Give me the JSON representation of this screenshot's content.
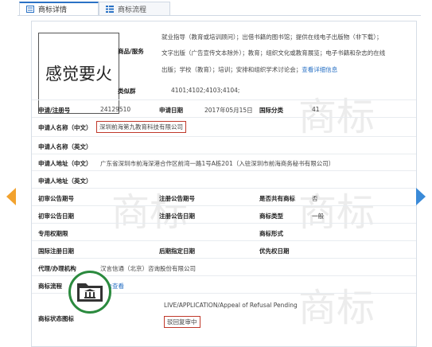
{
  "tabs": [
    {
      "label": "商标详情"
    },
    {
      "label": "商标流程"
    }
  ],
  "watermark": "商标",
  "trademark_name": "感觉要火",
  "goods_label": "商品/服务",
  "goods_lines": [
    "就业指导（教育或培训顾问）；出借书籍的图书馆；提供在线电子出版物（非下载）；",
    "文字出版（广告宣传文本除外）；教育；组织文化或教育展览；电子书籍和杂志的在线",
    "出版；学校（教育）；培训；安排和组织学术讨论会；查看详细信息"
  ],
  "goods_more": "查看详细信息",
  "group_label": "类似群",
  "group_value": "4101;4102;4103;4104;",
  "rows": {
    "reg_no_label": "申请/注册号",
    "reg_no": "24129510",
    "app_date_label": "申请日期",
    "app_date": "2017年05月15日",
    "class_label": "国际分类",
    "class_value": "41",
    "applicant_cn_label": "申请人名称（中文）",
    "applicant_cn": "深圳前海第九教育科技有限公司",
    "applicant_en_label": "申请人名称（英文）",
    "address_cn_label": "申请人地址（中文）",
    "address_cn": "广东省深圳市前海深港合作区前湾一路1号A栋201（入驻深圳市前海商务秘书有限公司）",
    "address_en_label": "申请人地址（英文）",
    "prelim_no_label": "初审公告期号",
    "reg_pub_no_label": "注册公告期号",
    "shared_label": "是否共有商标",
    "shared_value": "否",
    "prelim_date_label": "初审公告日期",
    "reg_pub_date_label": "注册公告日期",
    "type_label": "商标类型",
    "type_value": "一般",
    "exclusive_label": "专用权期限",
    "form_label": "商标形式",
    "intl_date_label": "国际注册日期",
    "later_date_label": "后期指定日期",
    "priority_label": "优先权日期",
    "agent_label": "代理/办理机构",
    "agent_value": "汉言信通（北京）咨询股份有限公司",
    "process_label": "商标流程",
    "process_link": "点击查看",
    "status_label": "商标状态图标",
    "status_en": "LIVE/APPLICATION/Appeal of Refusal Pending",
    "status_cn": "驳回复审中"
  },
  "colors": {
    "accent": "#2a72c5",
    "highlight": "#c0392b",
    "status_ring": "#2b8a3e",
    "arrow_left": "#f2a22e",
    "arrow_right": "#3a8ad8"
  }
}
